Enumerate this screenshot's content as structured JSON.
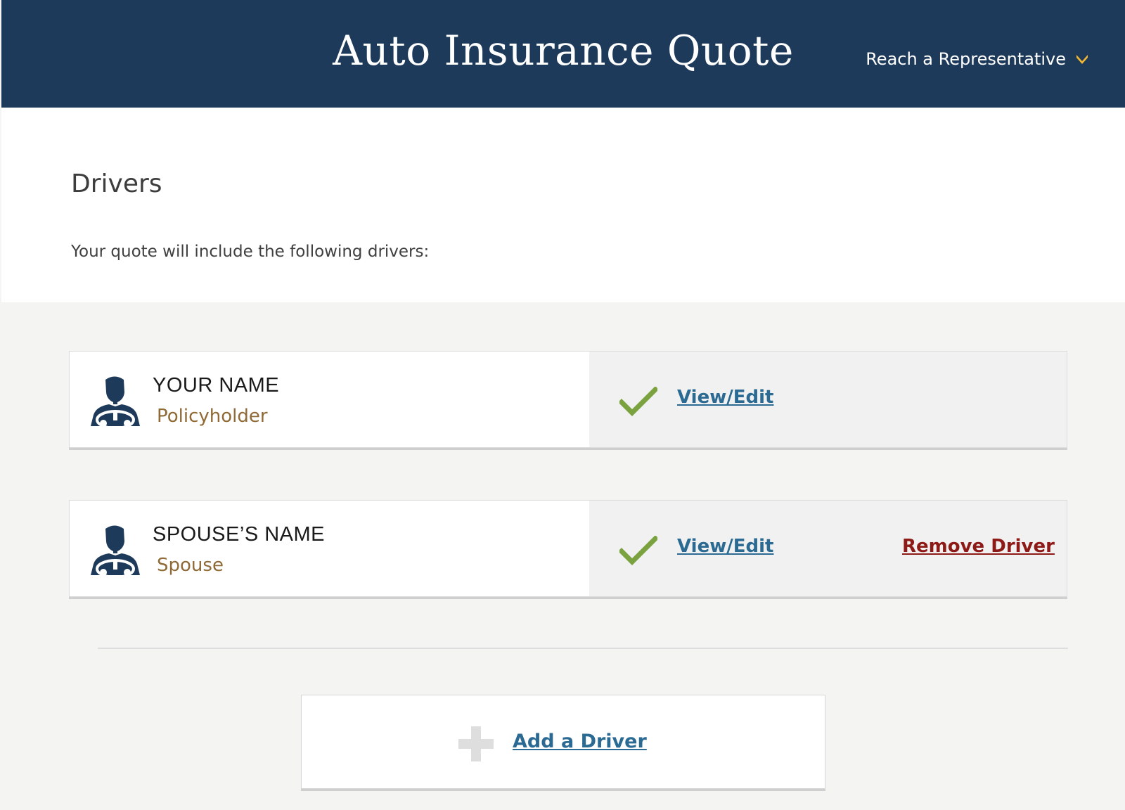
{
  "header": {
    "title": "Auto Insurance Quote",
    "rep_link": "Reach a Representative"
  },
  "intro": {
    "title": "Drivers",
    "description": "Your quote will include the following drivers:"
  },
  "drivers": [
    {
      "name": "YOUR NAME",
      "role": "Policyholder",
      "status": "complete",
      "view_edit": "View/Edit"
    },
    {
      "name": "SPOUSE’S NAME",
      "role": "Spouse",
      "status": "complete",
      "view_edit": "View/Edit",
      "remove": "Remove Driver"
    }
  ],
  "add_driver": {
    "label": "Add a Driver"
  },
  "icons": {
    "rep_chevron": "chevron-down-icon",
    "driver": "driver-avatar-icon",
    "check": "check-icon",
    "add": "plus-icon"
  },
  "colors": {
    "header_bg": "#1e3a5a",
    "accent_gold": "#f2b632",
    "link_blue": "#2b6a92",
    "remove_red": "#8e1a17",
    "role_brown": "#8f6a36",
    "check_green": "#7aa23f"
  }
}
